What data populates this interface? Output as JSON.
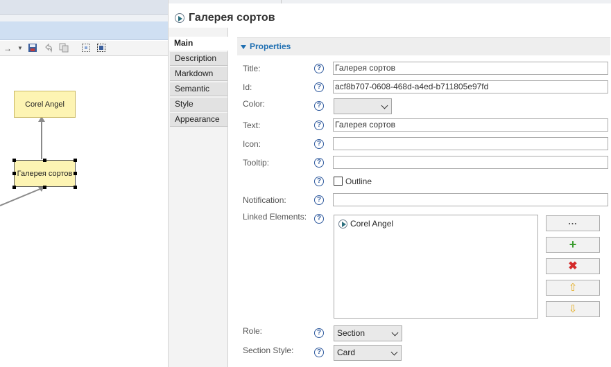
{
  "diagram": {
    "nodes": [
      {
        "label": "Corel Angel"
      },
      {
        "label": "Галерея сортов"
      }
    ],
    "toolbar_icons": [
      "arrow-right-icon",
      "dropdown-arrow-icon",
      "save-diagram-icon",
      "undo-icon",
      "copy-icon",
      "select-all-icon",
      "marquee-select-icon"
    ]
  },
  "properties": {
    "header_title": "Галерея сортов",
    "tabs": [
      {
        "label": "Main",
        "active": true
      },
      {
        "label": "Description"
      },
      {
        "label": "Markdown"
      },
      {
        "label": "Semantic"
      },
      {
        "label": "Style"
      },
      {
        "label": "Appearance"
      }
    ],
    "section_title": "Properties",
    "fields": {
      "title": {
        "label": "Title:",
        "value": "Галерея сортов"
      },
      "id": {
        "label": "Id:",
        "value": "acf8b707-0608-468d-a4ed-b711805e97fd"
      },
      "color": {
        "label": "Color:",
        "value": ""
      },
      "text": {
        "label": "Text:",
        "value": "Галерея сортов"
      },
      "icon": {
        "label": "Icon:",
        "value": ""
      },
      "tooltip": {
        "label": "Tooltip:",
        "value": ""
      },
      "outline": {
        "label": "Outline",
        "checked": false
      },
      "notification": {
        "label": "Notification:",
        "value": ""
      },
      "linked": {
        "label": "Linked Elements:",
        "items": [
          "Corel Angel"
        ]
      },
      "role": {
        "label": "Role:",
        "value": "Section"
      },
      "section_style": {
        "label": "Section Style:",
        "value": "Card"
      }
    },
    "help_glyph": "?",
    "buttons": {
      "browse": "...",
      "add": "+",
      "remove": "✖",
      "up": "⇧",
      "down": "⇩"
    }
  }
}
